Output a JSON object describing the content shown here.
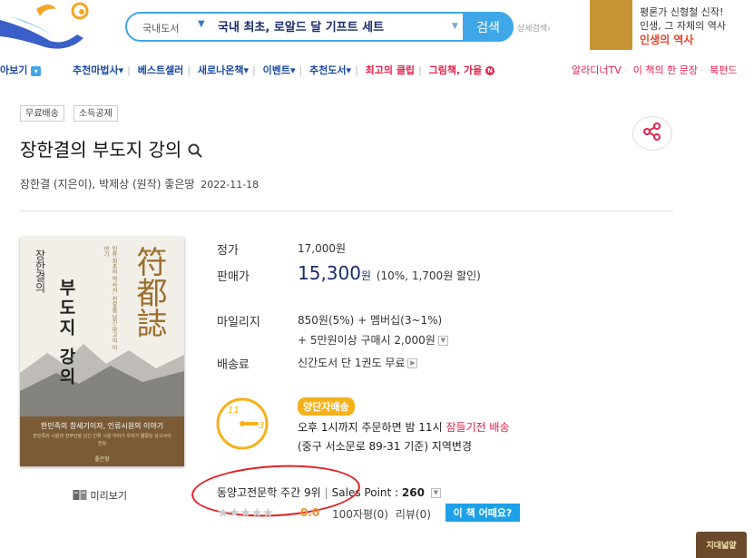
{
  "header": {
    "search": {
      "category": "국내도서",
      "query": "국내 최초, 로알드 달 기프트 세트",
      "button_label": "검색",
      "detail_label": "상세검색"
    },
    "ad": {
      "line1": "평론가 신형철 신작!",
      "line2": "인생, 그 자체의 역사",
      "line3": "인생의 역사"
    }
  },
  "nav": {
    "first": "아보기",
    "items": [
      "추천마법사",
      "베스트셀러",
      "새로나온책",
      "이벤트",
      "추천도서"
    ],
    "club": "최고의 클립",
    "goods": "그림책, 가을",
    "right": [
      "알라디너TV",
      "이 책의 한 문장",
      "북펀드"
    ]
  },
  "book": {
    "tags": [
      "무료배송",
      "소득공제"
    ],
    "title": "장한결의 부도지 강의",
    "author": "장한결 (지은이),",
    "original_author": "박제상 (원작)",
    "publisher": "좋은땅",
    "date": "2022-11-18",
    "preview_label": "미리보기",
    "cover": {
      "title_small": "장한결의",
      "title_big": "부도지 강의",
      "hanja": "符都誌",
      "subtitle": "인류 최초의 역사서, 천부를 남긴 마고의 이야기",
      "tagline": "한민족의 창세기이자, 인류시원의 이야기",
      "body": "한민족의 시원과 천부인을 남긴 인류 시원 이야기 우리가 몰랐던 상고사의 진실",
      "publisher": "좋은땅"
    }
  },
  "price": {
    "list_label": "정가",
    "list_value": "17,000원",
    "sale_label": "판매가",
    "sale_number": "15,300",
    "sale_unit": "원",
    "sale_note": "(10%, 1,700원 할인)"
  },
  "mileage": {
    "label": "마일리지",
    "line1": "850원(5%) + 멤버십(3~1%)",
    "line2": "+ 5만원이상 구매시 2,000원"
  },
  "shipping": {
    "label": "배송료",
    "value": "신간도서 단 1권도 무료"
  },
  "delivery": {
    "badge": "양단자배송",
    "clock_a": "11",
    "clock_b": "3",
    "line1_pre": "오후 1시까지 주문하면 밤 11시",
    "line1_pink": "잠들기전 배송",
    "line2": "(중구 서소문로 89-31 기준) 지역변경"
  },
  "ranking": {
    "rank_text": "동양고전문학 주간 9위",
    "sales_label": "Sales Point :",
    "sales_value": "260"
  },
  "rating": {
    "score": "0.0",
    "reviews_100": "100자평(0)",
    "reviews": "리뷰(0)",
    "how_button": "이 책 어때요?"
  },
  "corner_ad": "지대넓얕",
  "colors": {
    "accent_blue": "#3fa7e8",
    "pink": "#e8204a",
    "navy": "#1a2d6b",
    "annotation_red": "#e32026"
  }
}
